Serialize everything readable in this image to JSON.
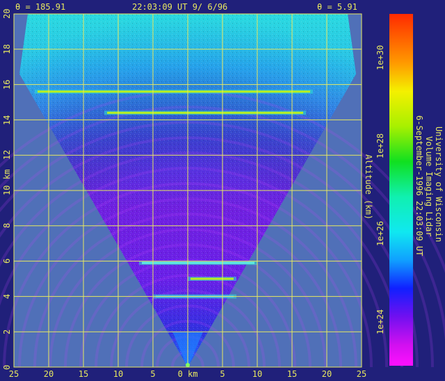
{
  "header": {
    "theta_left": "θ = 185.91",
    "timestamp": "22:03:09 UT  9/ 6/96",
    "theta_right": "θ = 5.91"
  },
  "axes": {
    "x_unit_label": "0 km",
    "y_unit_label": "km",
    "y_title": "Altitude (km)"
  },
  "colorbar": {
    "tick_labels": [
      "1e+30",
      "1e+28",
      "1e+26",
      "1e+24"
    ]
  },
  "credit": {
    "line1": "University of Wisconsin",
    "line2": "Volume Imaging Lidar",
    "line3": "6-September-1996 22:03:09 UT"
  },
  "colors": {
    "background": "#20207a",
    "outside_scan": "#5070b8",
    "grid": "#e8e860",
    "label": "#e8e860"
  },
  "chart_data": {
    "type": "heatmap",
    "title": "",
    "xlabel": "km",
    "ylabel": "Altitude (km)",
    "x_ticks": [
      "25",
      "20",
      "15",
      "10",
      "5",
      "0 km",
      "5",
      "10",
      "15",
      "20",
      "25"
    ],
    "y_ticks": [
      "0",
      "2",
      "4",
      "6",
      "8",
      "10",
      "12",
      "14",
      "16",
      "18",
      "20"
    ],
    "xlim": [
      -25,
      25
    ],
    "ylim": [
      0,
      20
    ],
    "grid": true,
    "scan_sector": {
      "apex_km": [
        0,
        0
      ],
      "edge_left_at_top_km": -23,
      "edge_right_at_top_km": 23
    },
    "colorbar": {
      "scale": "log",
      "range": [
        1e+23,
        1e+31
      ],
      "ticks": [
        1e+30,
        1e+28,
        1e+26,
        1e+24
      ]
    },
    "features": [
      {
        "altitude_km": 15.6,
        "x_range_km": [
          -22,
          18
        ],
        "intensity": "high"
      },
      {
        "altitude_km": 14.4,
        "x_range_km": [
          -12,
          17
        ],
        "intensity": "high"
      },
      {
        "altitude_km": 5.9,
        "x_range_km": [
          -7,
          10
        ],
        "intensity": "medium"
      },
      {
        "altitude_km": 5.0,
        "x_range_km": [
          0,
          7
        ],
        "intensity": "high"
      },
      {
        "altitude_km": 4.0,
        "x_range_km": [
          -5,
          7
        ],
        "intensity": "low"
      }
    ]
  }
}
